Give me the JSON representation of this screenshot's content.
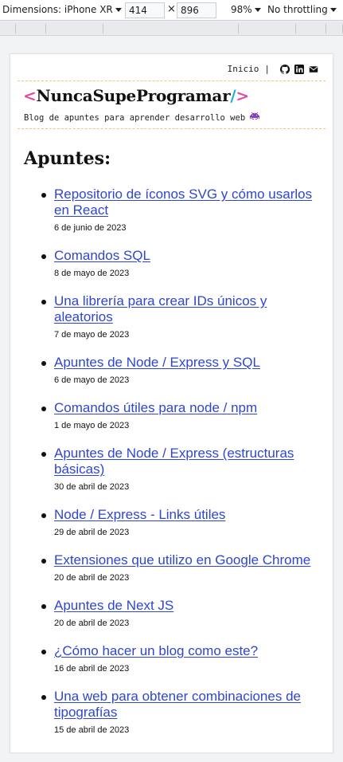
{
  "devtools": {
    "device_label": "Dimensions: iPhone XR",
    "width": "414",
    "height": "896",
    "times": "×",
    "zoom": "98%",
    "throttling": "No throttling"
  },
  "nav": {
    "home": "Inicio",
    "separator": "|",
    "icons": [
      "github-icon",
      "linkedin-icon",
      "mail-icon"
    ]
  },
  "brand": {
    "lt": "<",
    "name": "NuncaSupeProgramar",
    "slash": "/",
    "gt": ">",
    "tagline": "Blog de apuntes para aprender desarrollo web",
    "colors": {
      "angle": "#e0479e",
      "slash": "#1bb1cf",
      "divider": "#f2c680",
      "link": "#2e46d0"
    }
  },
  "section": {
    "title": "Apuntes:"
  },
  "posts": [
    {
      "title": "Repositorio de íconos SVG y cómo usarlos en React",
      "date": "6 de junio de 2023"
    },
    {
      "title": "Comandos SQL",
      "date": "8 de mayo de 2023"
    },
    {
      "title": "Una librería para crear IDs únicos y aleatorios",
      "date": "7 de mayo de 2023"
    },
    {
      "title": "Apuntes de Node / Express y SQL",
      "date": "6 de mayo de 2023"
    },
    {
      "title": "Comandos útiles para node / npm",
      "date": "1 de mayo de 2023"
    },
    {
      "title": "Apuntes de Node / Express (estructuras básicas)",
      "date": "30 de abril de 2023"
    },
    {
      "title": "Node / Express - Links útiles",
      "date": "29 de abril de 2023"
    },
    {
      "title": "Extensiones que utilizo en Google Chrome",
      "date": "20 de abril de 2023"
    },
    {
      "title": "Apuntes de Next JS",
      "date": "20 de abril de 2023"
    },
    {
      "title": "¿Cómo hacer un blog como este?",
      "date": "16 de abril de 2023"
    },
    {
      "title": "Una web para obtener combinaciones de tipografías",
      "date": "15 de abril de 2023"
    }
  ]
}
